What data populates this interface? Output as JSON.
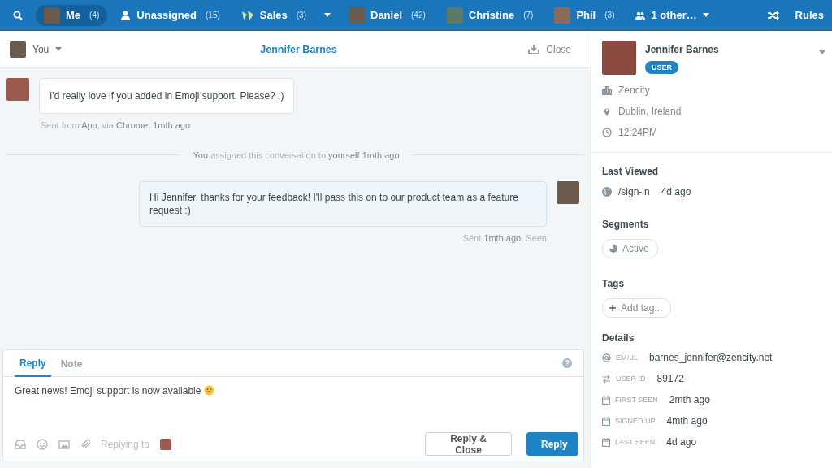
{
  "nav": {
    "items": [
      {
        "kind": "search",
        "selected": false
      },
      {
        "kind": "avatar",
        "label": "Me",
        "count": "(4)",
        "selected": true
      },
      {
        "kind": "person",
        "label": "Unassigned",
        "count": "(15)",
        "selected": false
      },
      {
        "kind": "team",
        "label": "Sales",
        "count": "(3)",
        "selected": false
      },
      {
        "kind": "caret",
        "selected": false
      },
      {
        "kind": "avatar",
        "label": "Daniel",
        "count": "(42)",
        "selected": false
      },
      {
        "kind": "avatar",
        "label": "Christine",
        "count": "(7)",
        "selected": false
      },
      {
        "kind": "avatar",
        "label": "Phil",
        "count": "(3)",
        "selected": false
      },
      {
        "kind": "group",
        "label": "1 other…",
        "selected": false
      }
    ],
    "rules": "Rules"
  },
  "conversation": {
    "assignee": "You",
    "title": "Jennifer Barnes",
    "close": "Close",
    "messages": [
      {
        "kind": "incoming",
        "text": "I'd really love if you added in Emoji support. Please? :)",
        "meta": "Sent from **App**, via **Chrome**, **1mth ago**"
      },
      {
        "kind": "event",
        "text": "**You** assigned this conversation to **yourself 1mth ago**"
      },
      {
        "kind": "outgoing",
        "text": "Hi Jennifer, thanks for your feedback! I'll pass this on to our product team as a feature request :)",
        "meta": "Sent **1mth ago**. Seen"
      }
    ]
  },
  "composer": {
    "tabs": [
      {
        "label": "Reply",
        "selected": true
      },
      {
        "label": "Note",
        "selected": false
      }
    ],
    "value": "Great news! Emoji support is now available",
    "replying_to": "Replying to",
    "buttons": [
      {
        "label": "Reply & Close",
        "kind": "secondary"
      },
      {
        "label": "Reply",
        "kind": "primary"
      }
    ]
  },
  "profile": {
    "name": "Jennifer Barnes",
    "badge": "USER",
    "company": "Zencity",
    "location": "Dublin, Ireland",
    "time": "12:24PM",
    "last_viewed": {
      "title": "Last Viewed",
      "page": "/sign-in",
      "when": "4d ago"
    },
    "segments": {
      "title": "Segments",
      "items": [
        "Active"
      ]
    },
    "tags": {
      "title": "Tags",
      "add": "Add tag..."
    },
    "details": {
      "title": "Details",
      "rows": [
        {
          "kind": "email",
          "label": "EMAIL",
          "value": "barnes_jennifer@zencity.net"
        },
        {
          "kind": "id",
          "label": "USER ID",
          "value": "89172"
        },
        {
          "kind": "date",
          "label": "FIRST SEEN",
          "value": "2mth ago"
        },
        {
          "kind": "date",
          "label": "SIGNED UP",
          "value": "4mth ago"
        },
        {
          "kind": "date",
          "label": "LAST SEEN",
          "value": "4d ago"
        }
      ]
    }
  }
}
